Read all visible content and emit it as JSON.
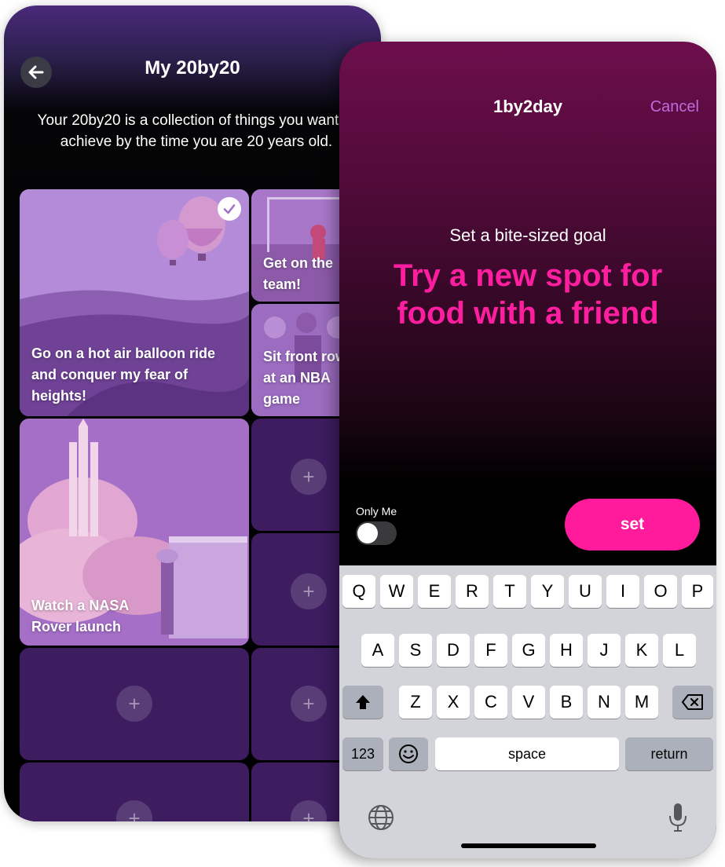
{
  "back_screen": {
    "title": "My 20by20",
    "intro": "Your 20by20 is a collection of things you want to achieve by the time you are 20 years old.",
    "tiles": [
      {
        "label": "Go on a hot air balloon ride and conquer my fear of heights!",
        "checked": true
      },
      {
        "label": "Get on the team!"
      },
      {
        "label": "Sit front row at an NBA game"
      },
      {
        "label": "Watch a NASA Rover launch"
      }
    ],
    "plus": "+"
  },
  "front_screen": {
    "title": "1by2day",
    "cancel_label": "Cancel",
    "subtitle": "Set a bite-sized goal",
    "goal_text": "Try a new spot for food with a friend",
    "only_me_label": "Only Me",
    "only_me_on": false,
    "set_label": "set"
  },
  "keyboard": {
    "row1": [
      "Q",
      "W",
      "E",
      "R",
      "T",
      "Y",
      "U",
      "I",
      "O",
      "P"
    ],
    "row2": [
      "A",
      "S",
      "D",
      "F",
      "G",
      "H",
      "J",
      "K",
      "L"
    ],
    "row3": [
      "Z",
      "X",
      "C",
      "V",
      "B",
      "N",
      "M"
    ],
    "numbers_label": "123",
    "space_label": "space",
    "return_label": "return"
  },
  "colors": {
    "accent_pink": "#ff1b9c",
    "cancel_purple": "#c06adf",
    "tile_purple": "#3d1c5f"
  }
}
